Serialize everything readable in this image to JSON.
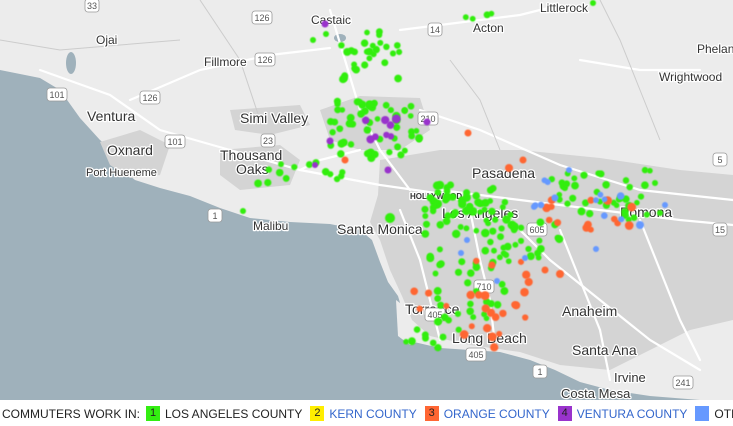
{
  "map": {
    "colors": {
      "water": "#9fb1bb",
      "land": "#ececec",
      "urban": "#d3d3d3",
      "roads": "#ffffff",
      "la": "#33ee11",
      "kern": "#ffee00",
      "orange": "#ff6633",
      "ventura": "#9933cc",
      "other": "#6699ff"
    },
    "places": [
      {
        "id": "castaic",
        "text": "Castaic"
      },
      {
        "id": "acton",
        "text": "Acton"
      },
      {
        "id": "littlerock",
        "text": "Littlerock"
      },
      {
        "id": "phelan",
        "text": "Phelan"
      },
      {
        "id": "wrightwood",
        "text": "Wrightwood"
      },
      {
        "id": "ojai",
        "text": "Ojai"
      },
      {
        "id": "fillmore",
        "text": "Fillmore"
      },
      {
        "id": "ventura",
        "text": "Ventura"
      },
      {
        "id": "simi",
        "text": "Simi Valley"
      },
      {
        "id": "oxnard",
        "text": "Oxnard"
      },
      {
        "id": "hueneme",
        "text": "Port Hueneme"
      },
      {
        "id": "thousand",
        "text": "Thousand"
      },
      {
        "id": "oaks",
        "text": "Oaks"
      },
      {
        "id": "malibu",
        "text": "Malibu"
      },
      {
        "id": "santamonica",
        "text": "Santa Monica"
      },
      {
        "id": "pasadena",
        "text": "Pasadena"
      },
      {
        "id": "losangeles",
        "text": "Los Angeles"
      },
      {
        "id": "pomona",
        "text": "Pomona"
      },
      {
        "id": "torrance",
        "text": "Torrance"
      },
      {
        "id": "longbeach",
        "text": "Long Beach"
      },
      {
        "id": "anaheim",
        "text": "Anaheim"
      },
      {
        "id": "santaana",
        "text": "Santa Ana"
      },
      {
        "id": "irvine",
        "text": "Irvine"
      },
      {
        "id": "costamesa",
        "text": "Costa Mesa"
      },
      {
        "id": "hollywood",
        "text": "HOLLYWOOD"
      }
    ],
    "shields": [
      {
        "id": "s33",
        "text": "33"
      },
      {
        "id": "s126a",
        "text": "126"
      },
      {
        "id": "s14",
        "text": "14"
      },
      {
        "id": "s126b",
        "text": "126"
      },
      {
        "id": "s101a",
        "text": "101"
      },
      {
        "id": "s126c",
        "text": "126"
      },
      {
        "id": "s23",
        "text": "23"
      },
      {
        "id": "s101b",
        "text": "101"
      },
      {
        "id": "s1a",
        "text": "1"
      },
      {
        "id": "s210",
        "text": "210"
      },
      {
        "id": "s605",
        "text": "605"
      },
      {
        "id": "s710",
        "text": "710"
      },
      {
        "id": "s405a",
        "text": "405"
      },
      {
        "id": "s405b",
        "text": "405"
      },
      {
        "id": "s1b",
        "text": "1"
      },
      {
        "id": "s15",
        "text": "15"
      },
      {
        "id": "s241",
        "text": "241"
      },
      {
        "id": "s5",
        "text": "5"
      }
    ]
  },
  "legend": {
    "title": "COMMUTERS WORK IN:",
    "items": [
      {
        "num": "1",
        "label": "LOS ANGELES COUNTY",
        "color": "#33ee11",
        "text_color": "#222222"
      },
      {
        "num": "2",
        "label": "KERN COUNTY",
        "color": "#ffee00",
        "text_color": "#3366cc"
      },
      {
        "num": "3",
        "label": "ORANGE COUNTY",
        "color": "#ff6633",
        "text_color": "#3366cc"
      },
      {
        "num": "4",
        "label": "VENTURA COUNTY",
        "color": "#9933cc",
        "text_color": "#3366cc"
      },
      {
        "num": "",
        "label": "OTHER",
        "color": "#6699ff",
        "text_color": "#222222"
      }
    ]
  }
}
